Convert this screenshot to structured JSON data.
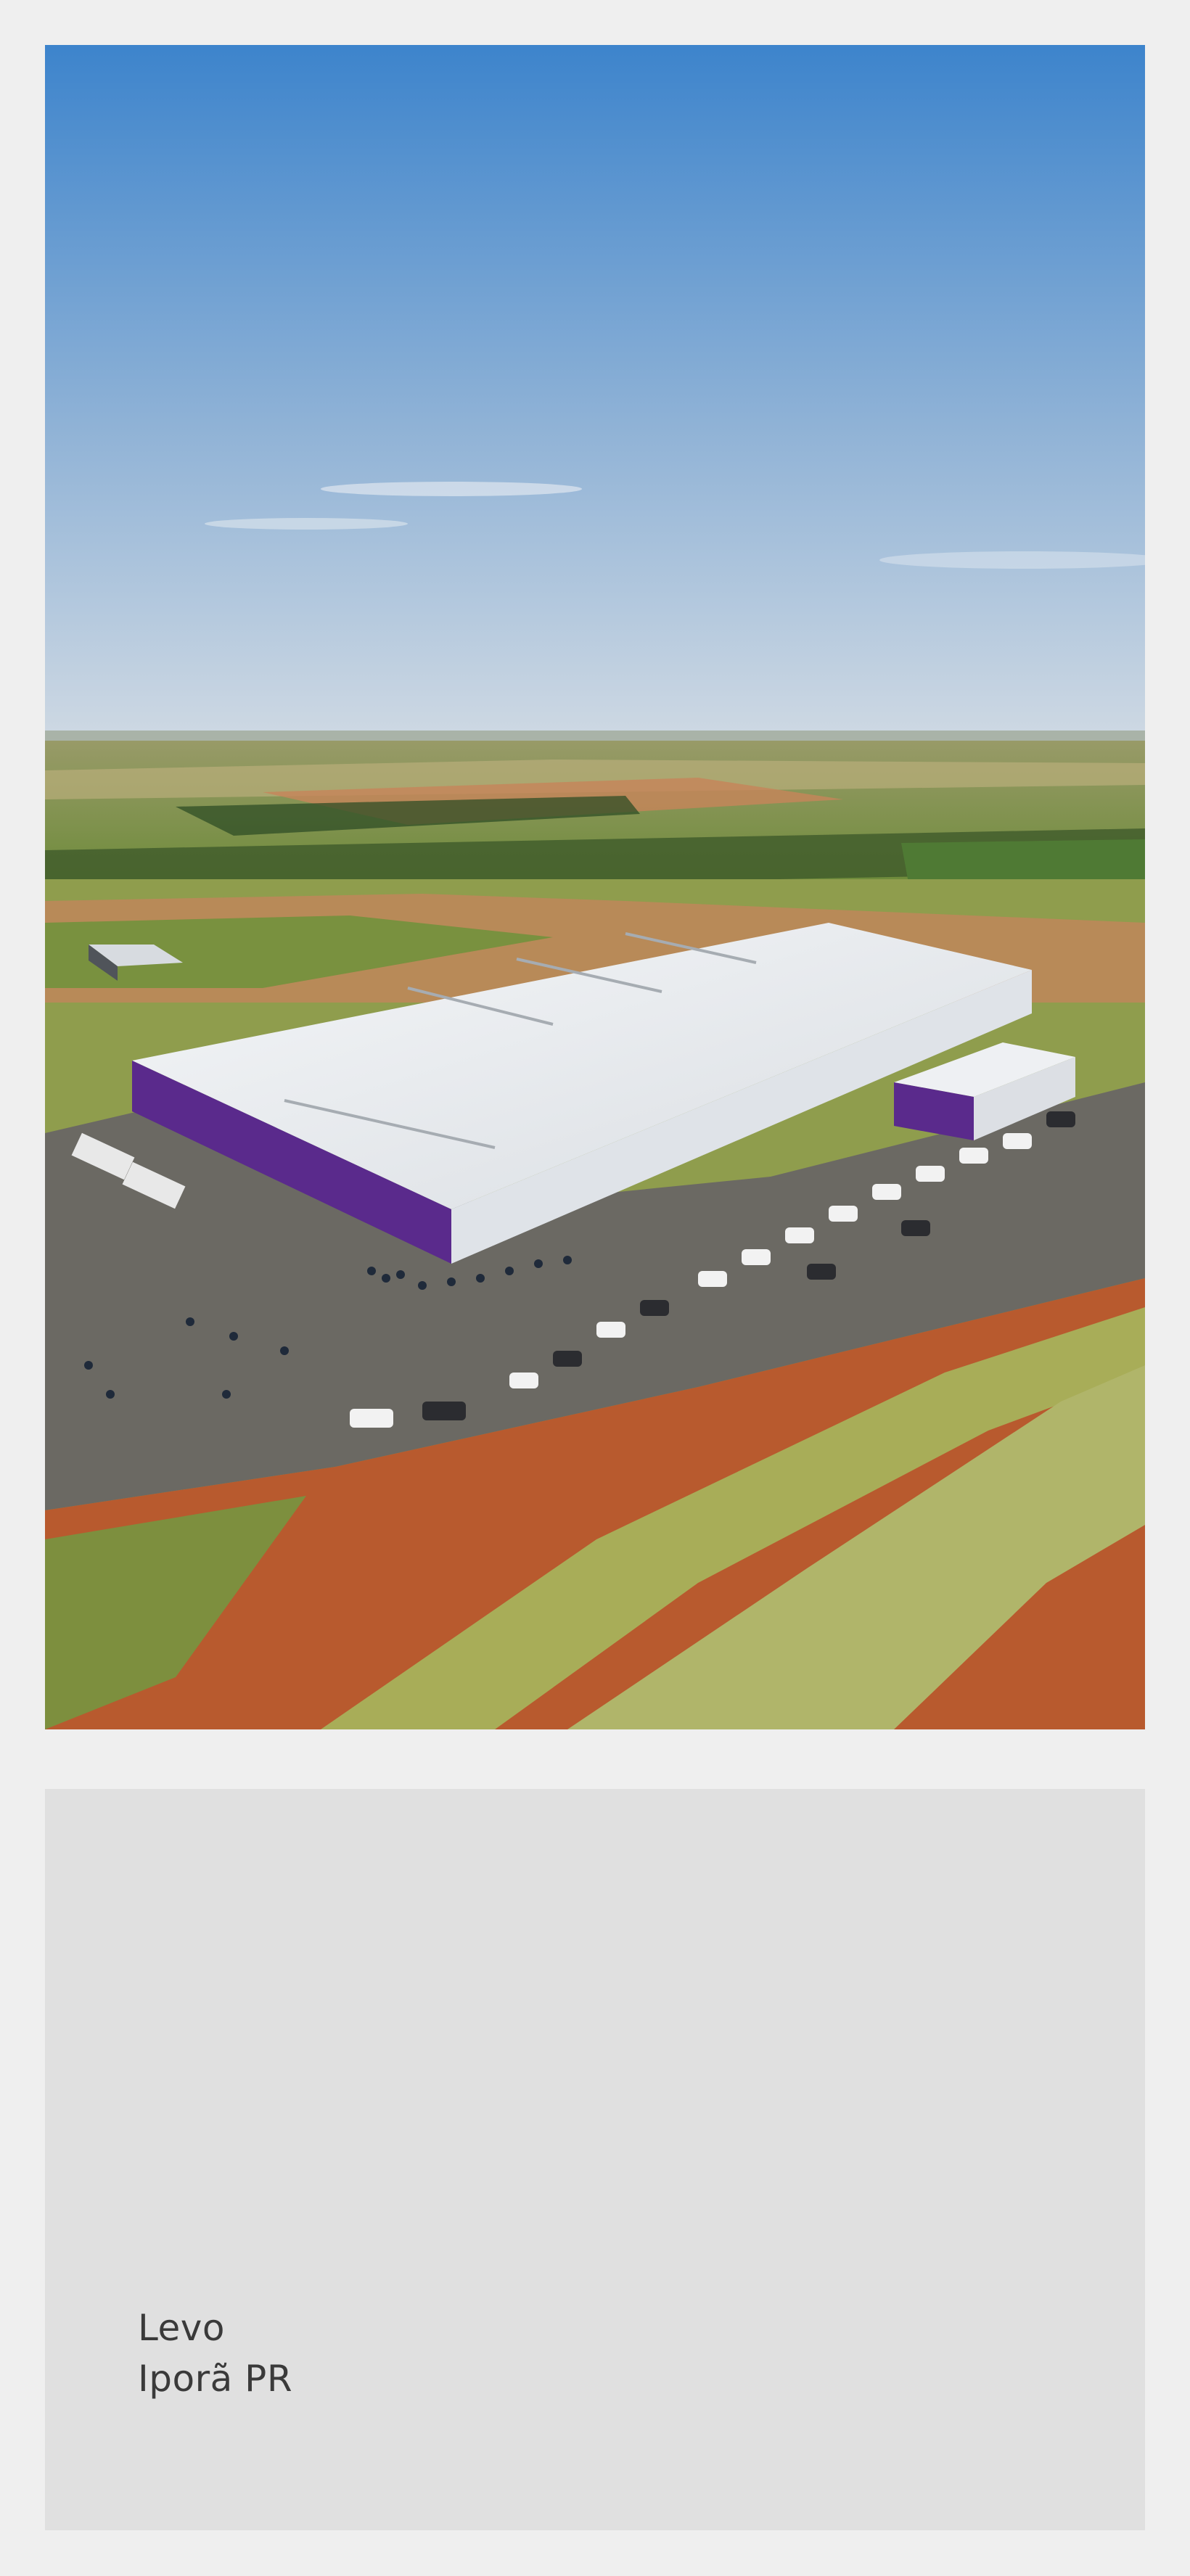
{
  "project_image": {
    "alt_subject": "aerial-view-of-factory",
    "colors": {
      "sky_top": "#3d84cc",
      "sky_bottom": "#c9d5e2",
      "roof": "#e9ecef",
      "facade_accent": "#5a2a8c",
      "soil": "#b85a2e",
      "grass": "#8f9d4d",
      "pavement": "#6b6963"
    }
  },
  "caption": {
    "line1": "Levo",
    "line2": "Iporã PR"
  }
}
